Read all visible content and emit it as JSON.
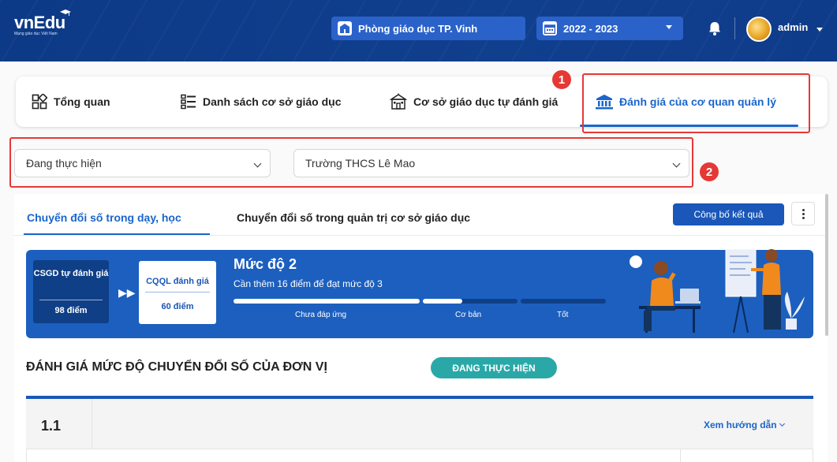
{
  "header": {
    "logo_text": "vnEdu",
    "logo_subtext": "Mạng giáo dục Việt Nam",
    "department": "Phòng giáo dục TP. Vinh",
    "school_year": "2022 - 2023",
    "user": "admin"
  },
  "main_tabs": [
    {
      "label": "Tổng quan",
      "icon": "grid-icon"
    },
    {
      "label": "Danh sách cơ sở giáo dục",
      "icon": "list-icon"
    },
    {
      "label": "Cơ sở giáo dục tự đánh giá",
      "icon": "school-icon"
    },
    {
      "label": "Đánh giá của cơ quan quản lý",
      "icon": "institution-icon",
      "active": true
    }
  ],
  "annotations": [
    "1",
    "2"
  ],
  "filters": {
    "status": "Đang thực hiện",
    "school": "Trường THCS Lê Mao"
  },
  "sub_tabs": [
    {
      "label": "Chuyển đổi số trong dạy, học",
      "active": true
    },
    {
      "label": "Chuyển đổi số trong quản trị cơ sở giáo dục"
    }
  ],
  "actions": {
    "publish": "Công bố kết quả"
  },
  "banner": {
    "self_eval_label": "CSGD tự đánh giá",
    "self_eval_score": "98 điểm",
    "agency_label": "CQQL đánh giá",
    "agency_score": "60 điểm",
    "level": "Mức độ 2",
    "need": "Cần thêm 16 điểm để đạt mức độ 3",
    "progress_labels": [
      "Chưa đáp ứng",
      "Cơ bản",
      "Tốt"
    ],
    "progress_fraction_basic": 0.42
  },
  "section": {
    "title": "ĐÁNH GIÁ MỨC ĐỘ CHUYỂN ĐỔI SỐ CỦA ĐƠN VỊ",
    "status": "ĐANG THỰC HIỆN"
  },
  "criteria": {
    "number": "1.1",
    "guide": "Xem hướng dẫn"
  },
  "colors": {
    "header_bg": "#0f3c8a",
    "accent": "#1a66cc",
    "annotation_red": "#e53935",
    "status_teal": "#2aa8a8"
  }
}
